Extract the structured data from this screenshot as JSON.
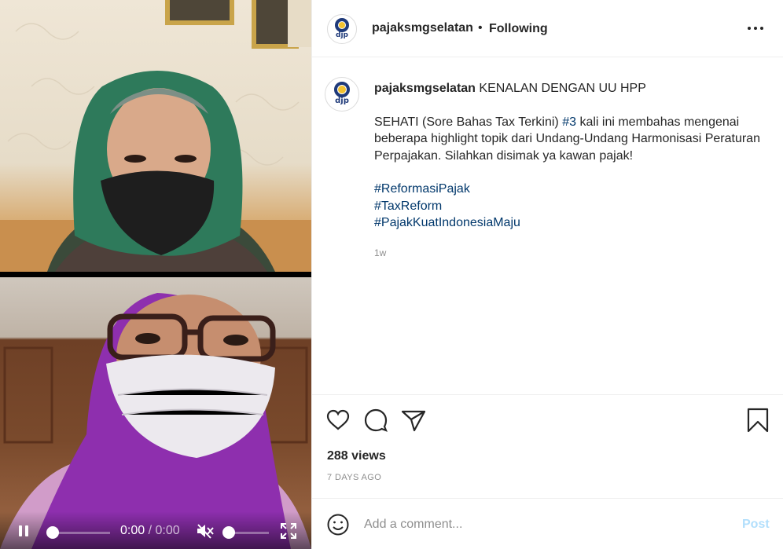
{
  "post": {
    "username": "pajaksmgselatan",
    "separator": "•",
    "follow_status": "Following",
    "avatar_logo_text": "djp",
    "caption": {
      "username": "pajaksmgselatan",
      "title": " KENALAN DENGAN UU HPP",
      "body_before_tag": "SEHATI (Sore Bahas Tax Terkini) ",
      "body_tag": "#3",
      "body_after_tag": " kali ini membahas mengenai beberapa highlight topik dari Undang-Undang Harmonisasi Peraturan Perpajakan. Silahkan disimak ya kawan pajak!",
      "hashtags": [
        "#ReformasiPajak",
        "#TaxReform",
        "#PajakKuatIndonesiaMaju"
      ]
    },
    "caption_age": "1w",
    "views": "288 views",
    "posted_ago": "7 DAYS AGO"
  },
  "video": {
    "current_time": "0:00",
    "time_separator": " / ",
    "duration": "0:00",
    "progress": 0.0,
    "volume": 0.0,
    "muted": true
  },
  "comment": {
    "placeholder": "Add a comment...",
    "post_label": "Post"
  },
  "icons": {
    "more": "more-horizontal-icon",
    "like": "heart-icon",
    "comment": "comment-bubble-icon",
    "share": "paper-plane-icon",
    "save": "bookmark-icon",
    "emoji": "smiley-icon",
    "play_pause": "pause-icon",
    "mute": "speaker-muted-icon",
    "fullscreen": "fullscreen-icon"
  },
  "colors": {
    "link": "#00376b",
    "post_disabled": "#b2dffc",
    "muted_text": "#8e8e8e",
    "border": "#efefef"
  }
}
